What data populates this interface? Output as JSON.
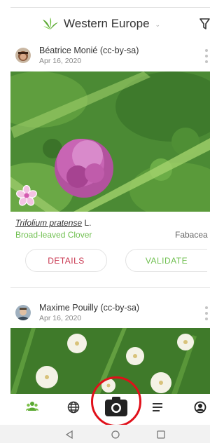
{
  "header": {
    "region": "Western Europe",
    "region_icon": "leaf-cluster-icon",
    "filter_icon": "filter-icon"
  },
  "feed": [
    {
      "author": "Béatrice Monié (cc-by-sa)",
      "date": "Apr 16, 2020",
      "scientific_name": "Trifolium pratense",
      "authority": "L.",
      "common_name": "Broad-leaved Clover",
      "family": "Fabacea",
      "details_label": "DETAILS",
      "validate_label": "VALIDATE",
      "organ_icon": "flower-organ-icon"
    },
    {
      "author": "Maxime Pouilly (cc-by-sa)",
      "date": "Apr 16, 2020"
    }
  ],
  "bottom_nav": [
    {
      "icon": "community-icon"
    },
    {
      "icon": "globe-icon"
    },
    {
      "icon": "camera-icon"
    },
    {
      "icon": "list-icon"
    },
    {
      "icon": "profile-icon"
    }
  ],
  "system_nav": [
    "back-icon",
    "home-icon",
    "recents-icon"
  ],
  "colors": {
    "accent_green": "#6fbf4f",
    "details_red": "#c8344e",
    "highlight_ring": "#e0101a"
  }
}
